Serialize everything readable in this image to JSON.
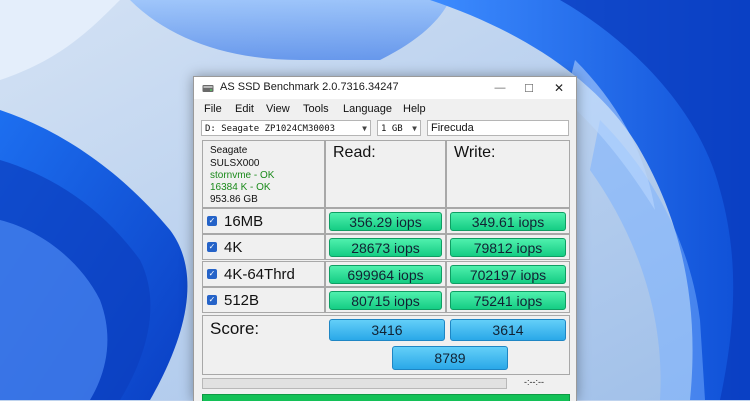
{
  "window": {
    "title": "AS SSD Benchmark 2.0.7316.34247",
    "controls": {
      "minimize": "—",
      "maximize": "☐",
      "close": "✕"
    }
  },
  "menu": [
    "File",
    "Edit",
    "View",
    "Tools",
    "Language",
    "Help"
  ],
  "toolbar": {
    "drive": "D: Seagate ZP1024CM30003",
    "size": "1 GB",
    "name": "Firecuda"
  },
  "drive_info": {
    "vendor": "Seagate",
    "firmware": "SULSX000",
    "driver": "stornvme - OK",
    "alignment": "16384 K - OK",
    "capacity": "953.86 GB"
  },
  "columns": {
    "read": "Read:",
    "write": "Write:"
  },
  "tests": [
    {
      "label": "16MB",
      "checked": true,
      "read": "356.29 iops",
      "write": "349.61 iops"
    },
    {
      "label": "4K",
      "checked": true,
      "read": "28673 iops",
      "write": "79812 iops"
    },
    {
      "label": "4K-64Thrd",
      "checked": true,
      "read": "699964 iops",
      "write": "702197 iops"
    },
    {
      "label": "512B",
      "checked": true,
      "read": "80715 iops",
      "write": "75241 iops"
    }
  ],
  "score": {
    "label": "Score:",
    "read": "3416",
    "write": "3614",
    "total": "8789"
  },
  "status": {
    "time": "-:--:--",
    "progress": 0
  },
  "colors": {
    "result_green": "#2fe09a",
    "score_blue": "#3db8f0",
    "info_green": "#1a8a1a",
    "status_bar": "#13c157"
  }
}
